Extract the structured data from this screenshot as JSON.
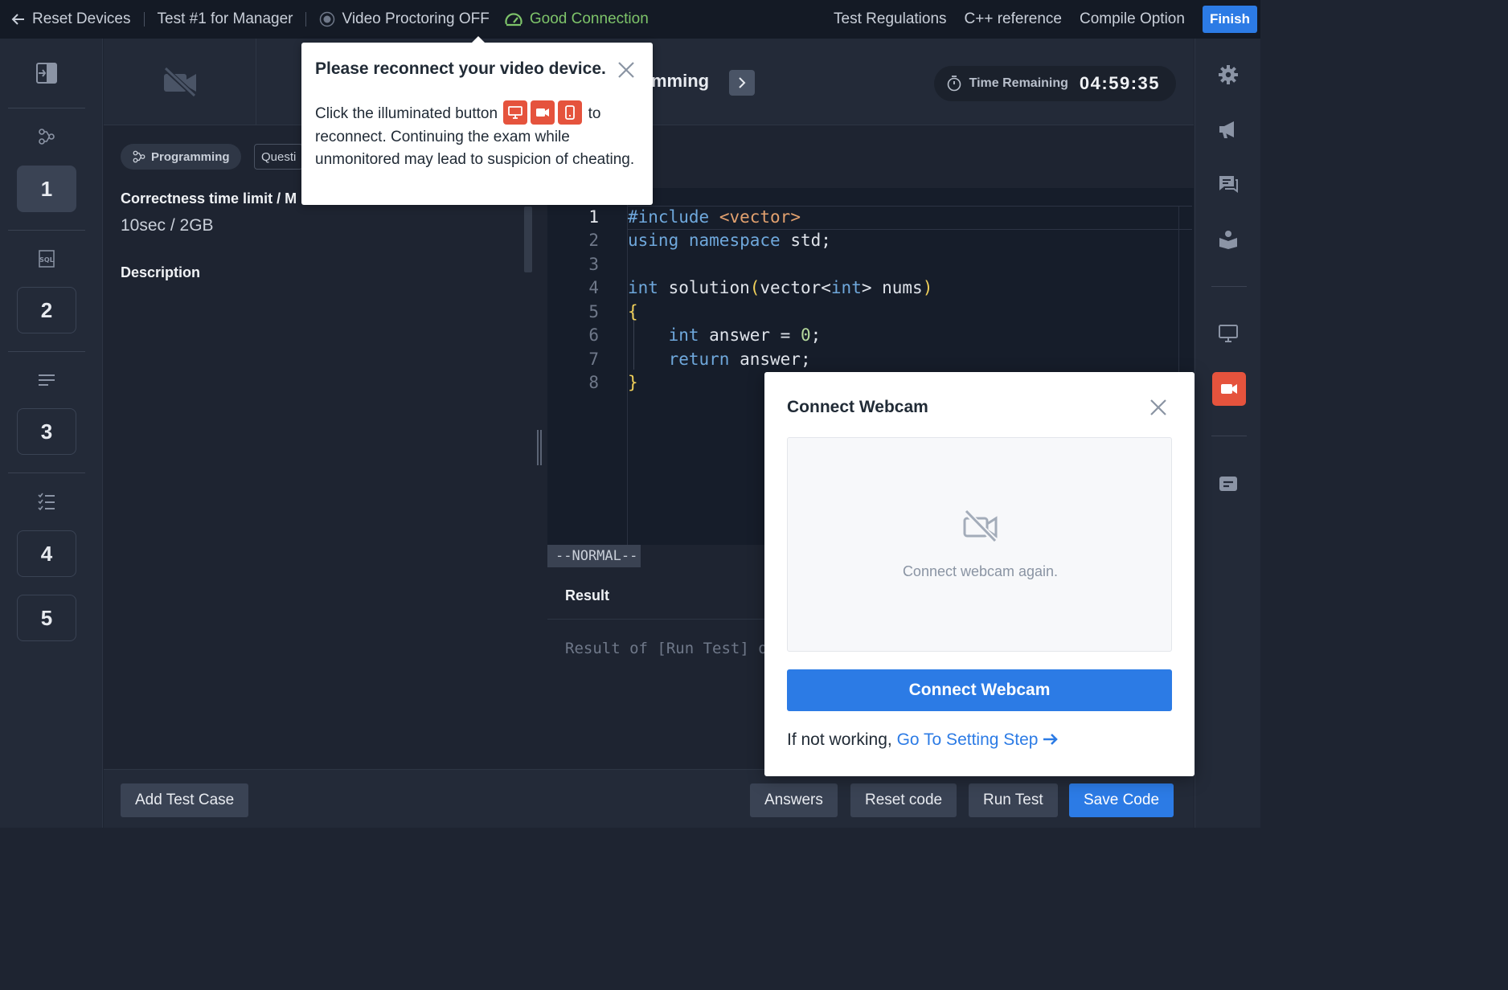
{
  "topbar": {
    "reset_devices": "Reset Devices",
    "test_name": "Test #1 for Manager",
    "video_proctoring": "Video Proctoring OFF",
    "connection": "Good Connection",
    "test_regulations": "Test Regulations",
    "cpp_reference": "C++ reference",
    "compile_option": "Compile Option",
    "finish": "Finish"
  },
  "leftnav": {
    "items": [
      {
        "icon": "programming-icon",
        "number": "1",
        "active": true
      },
      {
        "icon": "sql-icon",
        "number": "2"
      },
      {
        "icon": "text-lines-icon",
        "number": "3"
      },
      {
        "icon": "checklist-icon",
        "number": "4"
      },
      {
        "number": "5"
      }
    ]
  },
  "header": {
    "title_partial": "mming",
    "time_label": "Time Remaining",
    "time_value": "04:59:35"
  },
  "problem": {
    "tag_programming": "Programming",
    "tag_question_partial": "Questi",
    "limit_heading_partial": "Correctness time limit / M",
    "limit_value": "10sec / 2GB",
    "description_heading": "Description"
  },
  "editor": {
    "line_numbers": [
      "1",
      "2",
      "3",
      "4",
      "5",
      "6",
      "7",
      "8"
    ],
    "mode": "--NORMAL--"
  },
  "result": {
    "title": "Result",
    "placeholder_partial": "Result of [Run Test] or"
  },
  "bottombar": {
    "add_test_case": "Add Test Case",
    "answers": "Answers",
    "reset_code": "Reset code",
    "run_test": "Run Test",
    "save_code": "Save Code"
  },
  "popover": {
    "title": "Please reconnect your video device.",
    "body_before": "Click the illuminated button",
    "body_after": "to reconnect. Continuing the exam while unmonitored may lead to suspicion of cheating."
  },
  "modal": {
    "title": "Connect Webcam",
    "preview_text": "Connect webcam again.",
    "button": "Connect Webcam",
    "footer_text": "If not working,",
    "footer_link": "Go To Setting Step"
  },
  "colors": {
    "accent": "#2c7be5",
    "alert": "#e5533d",
    "good": "#7ec46a"
  }
}
